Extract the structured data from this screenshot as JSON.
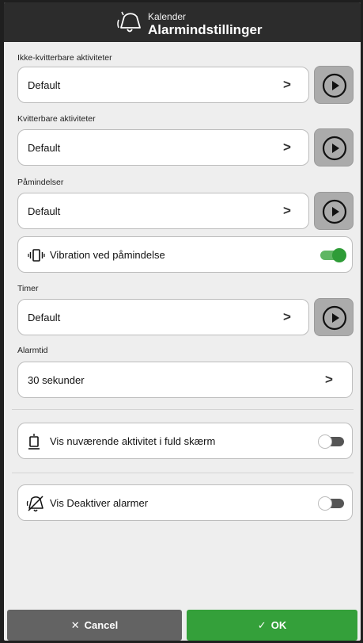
{
  "header": {
    "subtitle": "Kalender",
    "title": "Alarmindstillinger",
    "icon": "bell-ringing-icon"
  },
  "sections": {
    "non_ack": {
      "label": "Ikke-kvitterbare aktiviteter",
      "value": "Default"
    },
    "ack": {
      "label": "Kvitterbare aktiviteter",
      "value": "Default"
    },
    "reminders": {
      "label": "Påmindelser",
      "value": "Default"
    },
    "vibration": {
      "label": "Vibration ved påmindelse",
      "on": true
    },
    "timer": {
      "label": "Timer",
      "value": "Default"
    },
    "alarm_time": {
      "label": "Alarmtid",
      "value": "30 sekunder"
    },
    "fullscreen": {
      "label": "Vis nuværende aktivitet i fuld skærm",
      "on": false
    },
    "disable_alarms": {
      "label": "Vis Deaktiver alarmer",
      "on": false
    }
  },
  "chevron": ">",
  "footer": {
    "cancel": "Cancel",
    "ok": "OK",
    "cancel_icon": "✕",
    "ok_icon": "✓"
  },
  "colors": {
    "header_bg": "#2c2c2c",
    "ok_green": "#34a03a",
    "toggle_on": "#2e9c37",
    "cancel_gray": "#636363"
  }
}
